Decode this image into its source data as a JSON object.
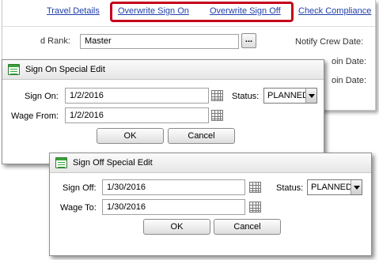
{
  "background_window": {
    "links": {
      "travel_details": "Travel Details",
      "overwrite_sign_on": "Overwrite Sign On",
      "overwrite_sign_off": "Overwrite Sign Off",
      "check_compliance": "Check Compliance"
    },
    "rank_label": "d Rank:",
    "rank_value": "Master",
    "rank_lookup_label": "...",
    "notify_label": "Notify Crew Date:",
    "partial_label_1": "oin Date:",
    "partial_label_2": "oin Date:",
    "highlight_color": "#c4001a",
    "link_color": "#1f3fa8"
  },
  "sign_on_dialog": {
    "title": "Sign On Special Edit",
    "sign_on_label": "Sign On:",
    "sign_on_value": "1/2/2016",
    "wage_from_label": "Wage From:",
    "wage_from_value": "1/2/2016",
    "status_label": "Status:",
    "status_value": "PLANNED",
    "ok_label": "OK",
    "cancel_label": "Cancel"
  },
  "sign_off_dialog": {
    "title": "Sign Off Special Edit",
    "sign_off_label": "Sign Off:",
    "sign_off_value": "1/30/2016",
    "wage_to_label": "Wage To:",
    "wage_to_value": "1/30/2016",
    "status_label": "Status:",
    "status_value": "PLANNED",
    "ok_label": "OK",
    "cancel_label": "Cancel"
  },
  "icons": {
    "dialog_icon": "form-icon",
    "date_picker": "calendar-icon",
    "dropdown": "chevron-down-icon"
  }
}
